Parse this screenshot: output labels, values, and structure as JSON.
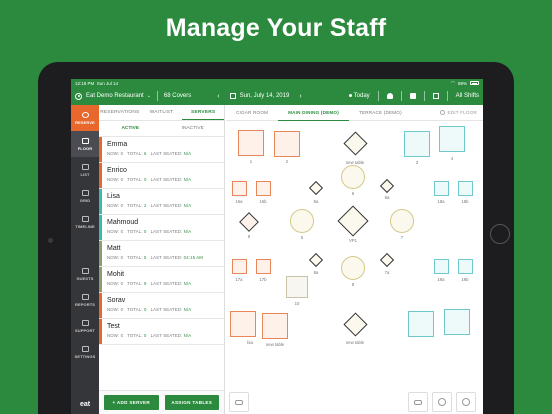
{
  "headline": "Manage Your Staff",
  "status_bar": {
    "time": "12:18 PM",
    "date": "Sun Jul 14",
    "battery": "88%"
  },
  "top_bar": {
    "restaurant": "Eat Demo Restaurant",
    "covers": "68 Covers",
    "date": "Sun, July 14, 2019",
    "today": "Today",
    "shifts": "All Shifts"
  },
  "sidebar": {
    "items": [
      {
        "label": "RESERVE",
        "icon": "plus-circle-icon"
      },
      {
        "label": "FLOOR",
        "icon": "grid-icon"
      },
      {
        "label": "LIST",
        "icon": "list-icon"
      },
      {
        "label": "GRID",
        "icon": "columns-icon"
      },
      {
        "label": "TIMELINE",
        "icon": "timeline-icon"
      },
      {
        "label": "GUESTS",
        "icon": "guests-icon"
      },
      {
        "label": "REPORTS",
        "icon": "reports-icon"
      },
      {
        "label": "SUPPORT",
        "icon": "chat-icon"
      },
      {
        "label": "SETTINGS",
        "icon": "gear-icon"
      }
    ],
    "brand": "eat"
  },
  "panel": {
    "tabs": [
      "RESERVATIONS",
      "WAITLIST",
      "SERVERS"
    ],
    "subtabs": [
      "ACTIVE",
      "INACTIVE"
    ],
    "stat_labels": {
      "now": "NOW:",
      "total": "TOTAL:",
      "last": "LAST SEATED:"
    },
    "servers": [
      {
        "name": "Emma",
        "now": "0",
        "total": "6",
        "last": "N/A",
        "color": "#e8672c"
      },
      {
        "name": "Enrico",
        "now": "0",
        "total": "0",
        "last": "N/A",
        "color": "#e8672c"
      },
      {
        "name": "Lisa",
        "now": "0",
        "total": "2",
        "last": "N/A",
        "color": "#3bb8b0"
      },
      {
        "name": "Mahmoud",
        "now": "0",
        "total": "0",
        "last": "N/A",
        "color": "#3bb8b0"
      },
      {
        "name": "Matt",
        "now": "0",
        "total": "5",
        "last": "04:15 AM",
        "color": "#8e9c6b"
      },
      {
        "name": "Mohit",
        "now": "0",
        "total": "9",
        "last": "N/A",
        "color": "#8e9c6b"
      },
      {
        "name": "Sorav",
        "now": "0",
        "total": "0",
        "last": "N/A",
        "color": "#e8672c"
      },
      {
        "name": "Test",
        "now": "0",
        "total": "0",
        "last": "N/A",
        "color": "#e8672c"
      }
    ],
    "add_server": "+ ADD SERVER",
    "assign_tables": "ASSIGN TABLES"
  },
  "floor": {
    "rooms": [
      "CIGAR ROOM",
      "MAIN DINING (DEMO)",
      "TERRACE (DEMO)"
    ],
    "edit_floor": "EDIT FLOOR",
    "labels": [
      "1",
      "2",
      "new table",
      "3",
      "4",
      "6",
      "16a",
      "16b",
      "5a",
      "8a",
      "18a",
      "18b",
      "9",
      "5",
      "VP1",
      "7",
      "17a",
      "17b",
      "8a",
      "7a",
      "19a",
      "19b",
      "10",
      "8",
      "bia",
      "new table",
      "new table"
    ]
  }
}
